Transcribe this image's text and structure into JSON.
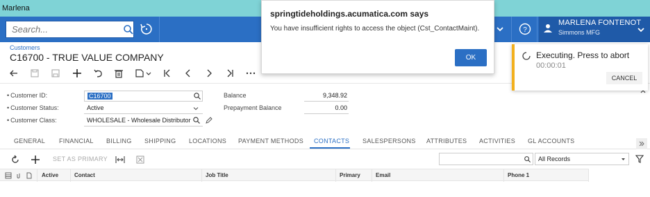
{
  "window": {
    "title": "Marlena"
  },
  "topbar": {
    "search_placeholder": "Search...",
    "user_name": "MARLENA FONTENOT",
    "user_company": "Simmons MFG"
  },
  "dialog": {
    "title": "springtideholdings.acumatica.com says",
    "message": "You have insufficient rights to access the object (Cst_ContactMaint).",
    "ok_label": "OK"
  },
  "executing": {
    "title": "Executing. Press to abort",
    "elapsed": "00:00:01",
    "cancel_label": "CANCEL"
  },
  "page": {
    "breadcrumb": "Customers",
    "title": "C16700 - TRUE VALUE COMPANY"
  },
  "form": {
    "customer_id_label": "Customer ID:",
    "customer_id_value": "C16700",
    "customer_status_label": "Customer Status:",
    "customer_status_value": "Active",
    "customer_class_label": "Customer Class:",
    "customer_class_value": "WHOLESALE - Wholesale Distributor",
    "balance_label": "Balance",
    "balance_value": "9,348.92",
    "prepayment_label": "Prepayment Balance",
    "prepayment_value": "0.00",
    "required_marker": "•"
  },
  "tabs": [
    "GENERAL",
    "FINANCIAL",
    "BILLING",
    "SHIPPING",
    "LOCATIONS",
    "PAYMENT METHODS",
    "CONTACTS",
    "SALESPERSONS",
    "ATTRIBUTES",
    "ACTIVITIES",
    "GL ACCOUNTS"
  ],
  "active_tab": "CONTACTS",
  "grid_toolbar": {
    "set_as_primary_label": "SET AS PRIMARY",
    "filter_value": "All Records"
  },
  "grid": {
    "headers": [
      "Active",
      "Contact",
      "Job Title",
      "Primary",
      "Email",
      "Phone 1"
    ]
  },
  "colors": {
    "accent": "#2b6fc4",
    "titlebar": "#7fd3d6",
    "warning": "#f2b01e"
  }
}
